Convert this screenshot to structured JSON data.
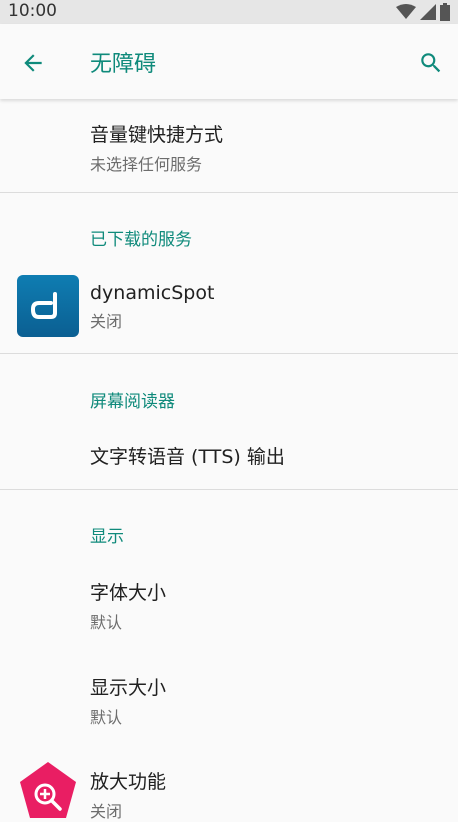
{
  "status_bar": {
    "time": "10:00"
  },
  "app_bar": {
    "title": "无障碍"
  },
  "items": {
    "volume_shortcut": {
      "title": "音量键快捷方式",
      "summary": "未选择任何服务"
    },
    "downloaded_section": {
      "title": "已下载的服务"
    },
    "dynamic_spot": {
      "title": "dynamicSpot",
      "summary": "关闭"
    },
    "screen_reader_section": {
      "title": "屏幕阅读器"
    },
    "tts_output": {
      "title": "文字转语音 (TTS) 输出"
    },
    "display_section": {
      "title": "显示"
    },
    "font_size": {
      "title": "字体大小",
      "summary": "默认"
    },
    "display_size": {
      "title": "显示大小",
      "summary": "默认"
    },
    "magnification": {
      "title": "放大功能",
      "summary": "关闭"
    }
  },
  "colors": {
    "accent": "#0f8a7b",
    "magnify_icon": "#e91e63",
    "dynamic_spot_icon": "#0f7db2"
  },
  "icons": {
    "back": "arrow-left",
    "search": "magnifier",
    "dynamic_spot": "d-logo",
    "magnification": "pentagon-magnifier-plus"
  }
}
